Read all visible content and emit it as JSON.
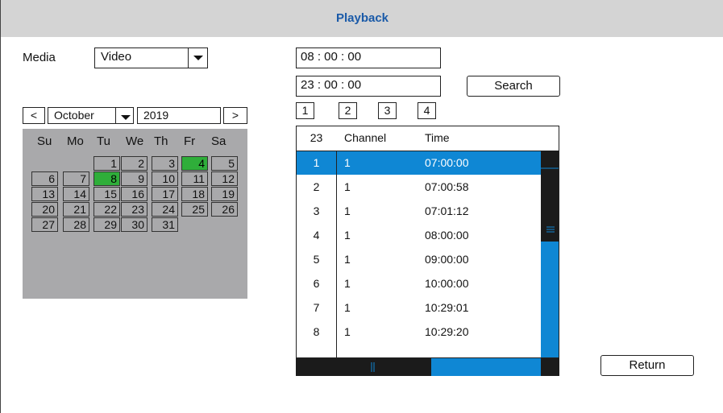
{
  "window": {
    "title": "Playback"
  },
  "media": {
    "label": "Media",
    "value": "Video"
  },
  "calendar": {
    "prev_label": "<",
    "next_label": ">",
    "month": "October",
    "year": "2019",
    "weekdays": [
      "Su",
      "Mo",
      "Tu",
      "We",
      "Th",
      "Fr",
      "Sa"
    ],
    "days": [
      "1",
      "2",
      "3",
      "4",
      "5",
      "6",
      "7",
      "8",
      "9",
      "10",
      "11",
      "12",
      "13",
      "14",
      "15",
      "16",
      "17",
      "18",
      "19",
      "20",
      "21",
      "22",
      "23",
      "24",
      "25",
      "26",
      "27",
      "28",
      "29",
      "30",
      "31"
    ],
    "first_weekday_index": 2,
    "highlighted_days": [
      "4",
      "8"
    ],
    "highlight_color": "#2fae3a"
  },
  "time_range": {
    "start": "08 : 00 : 00",
    "end": "23 : 00 : 00"
  },
  "search_label": "Search",
  "channel_buttons": [
    "1",
    "2",
    "3",
    "4"
  ],
  "results": {
    "count_header": "23",
    "channel_header": "Channel",
    "time_header": "Time",
    "selected_index": 0,
    "selection_color": "#0f87d4",
    "rows": [
      {
        "index": "1",
        "channel": "1",
        "time": "07:00:00"
      },
      {
        "index": "2",
        "channel": "1",
        "time": "07:00:58"
      },
      {
        "index": "3",
        "channel": "1",
        "time": "07:01:12"
      },
      {
        "index": "4",
        "channel": "1",
        "time": "08:00:00"
      },
      {
        "index": "5",
        "channel": "1",
        "time": "09:00:00"
      },
      {
        "index": "6",
        "channel": "1",
        "time": "10:00:00"
      },
      {
        "index": "7",
        "channel": "1",
        "time": "10:29:01"
      },
      {
        "index": "8",
        "channel": "1",
        "time": "10:29:20"
      }
    ]
  },
  "return_label": "Return"
}
